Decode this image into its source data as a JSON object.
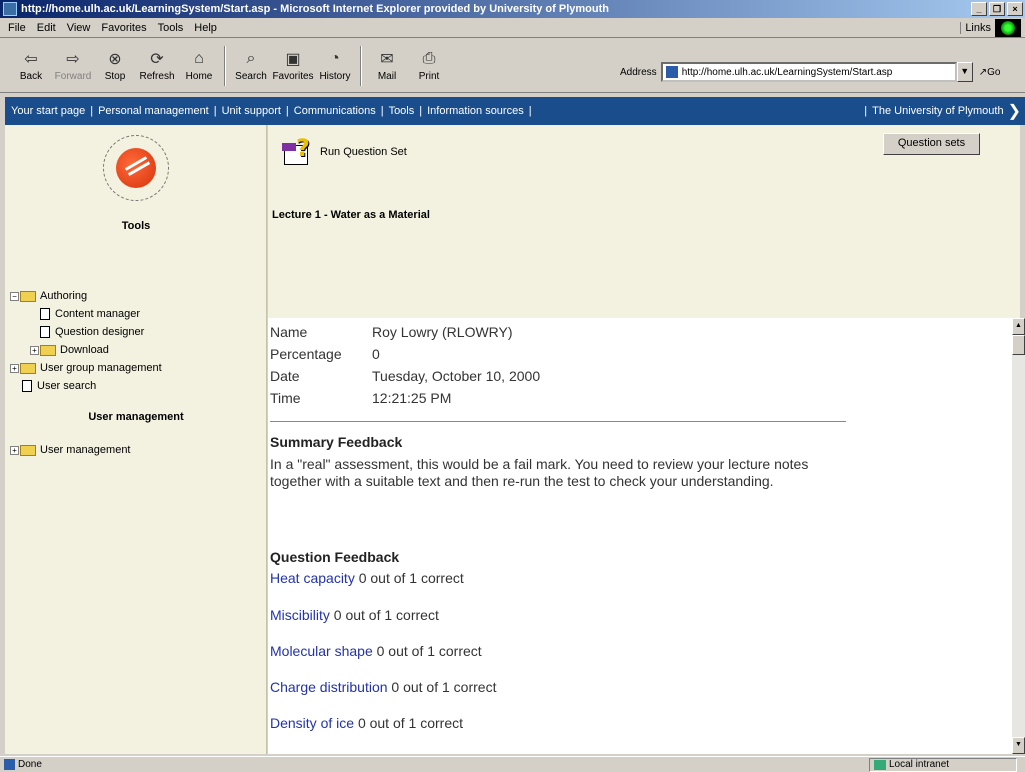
{
  "window": {
    "title": "http://home.ulh.ac.uk/LearningSystem/Start.asp - Microsoft Internet Explorer provided by University of Plymouth"
  },
  "menu": {
    "items": [
      "File",
      "Edit",
      "View",
      "Favorites",
      "Tools",
      "Help"
    ],
    "links_label": "Links"
  },
  "toolbar": {
    "back": "Back",
    "forward": "Forward",
    "stop": "Stop",
    "refresh": "Refresh",
    "home": "Home",
    "search": "Search",
    "favorites": "Favorites",
    "history": "History",
    "mail": "Mail",
    "print": "Print",
    "address_label": "Address",
    "address_value": "http://home.ulh.ac.uk/LearningSystem/Start.asp",
    "go_label": "Go"
  },
  "nav": {
    "items": [
      "Your start page",
      "Personal management",
      "Unit support",
      "Communications",
      "Tools",
      "Information sources"
    ],
    "university": "The University of Plymouth"
  },
  "sidebar": {
    "heading": "Tools",
    "authoring": "Authoring",
    "content_manager": "Content manager",
    "question_designer": "Question designer",
    "download": "Download",
    "user_group_management": "User group management",
    "user_search": "User search",
    "user_mgmt_heading": "User management",
    "user_management": "User management"
  },
  "header": {
    "run_label": "Run Question Set",
    "question_sets_button": "Question sets",
    "lecture_title": "Lecture 1 - Water as a Material"
  },
  "result": {
    "name_label": "Name",
    "name_value": "Roy Lowry (RLOWRY)",
    "percentage_label": "Percentage",
    "percentage_value": "0",
    "date_label": "Date",
    "date_value": "Tuesday, October 10, 2000",
    "time_label": "Time",
    "time_value": "12:21:25 PM"
  },
  "summary": {
    "heading": "Summary Feedback",
    "text": "In a \"real\" assessment, this would be a fail mark. You need to review your lecture notes together with a suitable text and then re-run the test to check your understanding."
  },
  "feedback": {
    "heading": "Question Feedback",
    "items": [
      {
        "topic": "Heat capacity",
        "result": "0 out of 1 correct"
      },
      {
        "topic": "Miscibility",
        "result": "0 out of 1 correct"
      },
      {
        "topic": "Molecular shape",
        "result": "0 out of 1 correct"
      },
      {
        "topic": "Charge distribution",
        "result": "0 out of 1 correct"
      },
      {
        "topic": "Density of ice",
        "result": "0 out of 1 correct"
      }
    ]
  },
  "status": {
    "text": "Done",
    "zone": "Local intranet"
  },
  "colors": {
    "nav_bg": "#1a4d8c",
    "panel_bg": "#f3f1df",
    "link": "#2233aa"
  }
}
